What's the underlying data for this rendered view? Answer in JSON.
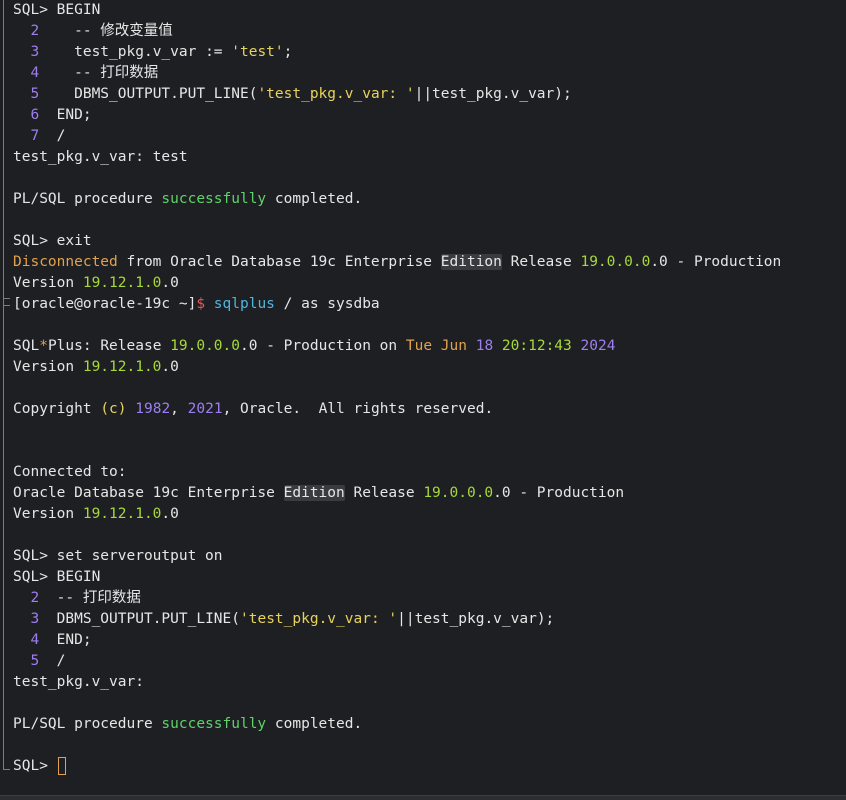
{
  "lines": [
    [
      {
        "t": "SQL> BEGIN",
        "c": "t-normal"
      }
    ],
    [
      {
        "t": "  2",
        "c": "t-num"
      },
      {
        "t": "    -- 修改变量值",
        "c": "t-normal"
      }
    ],
    [
      {
        "t": "  3",
        "c": "t-num"
      },
      {
        "t": "    test_pkg.v_var := ",
        "c": "t-normal"
      },
      {
        "t": "'test'",
        "c": "t-yellow"
      },
      {
        "t": ";",
        "c": "t-normal"
      }
    ],
    [
      {
        "t": "  4",
        "c": "t-num"
      },
      {
        "t": "    -- 打印数据",
        "c": "t-normal"
      }
    ],
    [
      {
        "t": "  5",
        "c": "t-num"
      },
      {
        "t": "    DBMS_OUTPUT.PUT_LINE(",
        "c": "t-normal"
      },
      {
        "t": "'test_pkg.v_var: '",
        "c": "t-yellow"
      },
      {
        "t": "||test_pkg.v_var);",
        "c": "t-normal"
      }
    ],
    [
      {
        "t": "  6",
        "c": "t-num"
      },
      {
        "t": "  END;",
        "c": "t-normal"
      }
    ],
    [
      {
        "t": "  7",
        "c": "t-num"
      },
      {
        "t": "  /",
        "c": "t-normal"
      }
    ],
    [
      {
        "t": "test_pkg.v_var: test",
        "c": "t-normal"
      }
    ],
    [],
    [
      {
        "t": "PL/SQL procedure ",
        "c": "t-normal"
      },
      {
        "t": "successfully",
        "c": "t-green"
      },
      {
        "t": " completed.",
        "c": "t-normal"
      }
    ],
    [],
    [
      {
        "t": "SQL> exit",
        "c": "t-normal"
      }
    ],
    [
      {
        "t": "Disconnected",
        "c": "t-orange"
      },
      {
        "t": " from Oracle Database 19c Enterprise ",
        "c": "t-normal"
      },
      {
        "t": "Edition",
        "c": "t-normal",
        "hl": true
      },
      {
        "t": " Release ",
        "c": "t-normal"
      },
      {
        "t": "19.0.0.0",
        "c": "t-ygreen"
      },
      {
        "t": ".0 - Production",
        "c": "t-normal"
      }
    ],
    [
      {
        "t": "Version ",
        "c": "t-normal"
      },
      {
        "t": "19.12.1.0",
        "c": "t-ygreen"
      },
      {
        "t": ".0",
        "c": "t-normal"
      }
    ],
    [
      {
        "t": "[oracle@oracle-19c ~]",
        "c": "t-normal"
      },
      {
        "t": "$",
        "c": "t-red"
      },
      {
        "t": " sqlplus",
        "c": "t-cyan"
      },
      {
        "t": " / as sysdba",
        "c": "t-normal"
      }
    ],
    [],
    [
      {
        "t": "SQL",
        "c": "t-normal"
      },
      {
        "t": "*",
        "c": "t-orange"
      },
      {
        "t": "Plus: Release ",
        "c": "t-normal"
      },
      {
        "t": "19.0.0.0",
        "c": "t-ygreen"
      },
      {
        "t": ".0 - Production on ",
        "c": "t-normal"
      },
      {
        "t": "Tue Jun ",
        "c": "t-orange"
      },
      {
        "t": "18",
        "c": "t-num"
      },
      {
        "t": " ",
        "c": "t-normal"
      },
      {
        "t": "20:12:43",
        "c": "t-ygreen"
      },
      {
        "t": " ",
        "c": "t-normal"
      },
      {
        "t": "2024",
        "c": "t-num"
      }
    ],
    [
      {
        "t": "Version ",
        "c": "t-normal"
      },
      {
        "t": "19.12.1.0",
        "c": "t-ygreen"
      },
      {
        "t": ".0",
        "c": "t-normal"
      }
    ],
    [],
    [
      {
        "t": "Copyright ",
        "c": "t-normal"
      },
      {
        "t": "(c)",
        "c": "t-yellow"
      },
      {
        "t": " ",
        "c": "t-normal"
      },
      {
        "t": "1982",
        "c": "t-num"
      },
      {
        "t": ", ",
        "c": "t-normal"
      },
      {
        "t": "2021",
        "c": "t-num"
      },
      {
        "t": ", Oracle.  All rights reserved.",
        "c": "t-normal"
      }
    ],
    [],
    [],
    [
      {
        "t": "Connected to:",
        "c": "t-normal"
      }
    ],
    [
      {
        "t": "Oracle Database 19c Enterprise ",
        "c": "t-normal"
      },
      {
        "t": "Edition",
        "c": "t-normal",
        "hl": true
      },
      {
        "t": " Release ",
        "c": "t-normal"
      },
      {
        "t": "19.0.0.0",
        "c": "t-ygreen"
      },
      {
        "t": ".0 - Production",
        "c": "t-normal"
      }
    ],
    [
      {
        "t": "Version ",
        "c": "t-normal"
      },
      {
        "t": "19.12.1.0",
        "c": "t-ygreen"
      },
      {
        "t": ".0",
        "c": "t-normal"
      }
    ],
    [],
    [
      {
        "t": "SQL> set serveroutput on",
        "c": "t-normal"
      }
    ],
    [
      {
        "t": "SQL> BEGIN",
        "c": "t-normal"
      }
    ],
    [
      {
        "t": "  2",
        "c": "t-num"
      },
      {
        "t": "  -- 打印数据",
        "c": "t-normal"
      }
    ],
    [
      {
        "t": "  3",
        "c": "t-num"
      },
      {
        "t": "  DBMS_OUTPUT.PUT_LINE(",
        "c": "t-normal"
      },
      {
        "t": "'test_pkg.v_var: '",
        "c": "t-yellow"
      },
      {
        "t": "||test_pkg.v_var);",
        "c": "t-normal"
      }
    ],
    [
      {
        "t": "  4",
        "c": "t-num"
      },
      {
        "t": "  END;",
        "c": "t-normal"
      }
    ],
    [
      {
        "t": "  5",
        "c": "t-num"
      },
      {
        "t": "  /",
        "c": "t-normal"
      }
    ],
    [
      {
        "t": "test_pkg.v_var:",
        "c": "t-normal"
      }
    ],
    [],
    [
      {
        "t": "PL/SQL procedure ",
        "c": "t-normal"
      },
      {
        "t": "successfully",
        "c": "t-green"
      },
      {
        "t": " completed.",
        "c": "t-normal"
      }
    ],
    [],
    [
      {
        "t": "SQL> ",
        "c": "t-normal",
        "cursor": true
      }
    ]
  ],
  "colors": {
    "background": "#1e1f22",
    "text": "#e6e6e6",
    "line_number": "#9d7ff0",
    "success": "#5fd26a",
    "version": "#a6d83a",
    "string": "#e8d35a",
    "warning": "#e0a24e",
    "command": "#4fb6e0",
    "prompt_symbol": "#e05a5a",
    "highlight_bg": "#3a3b40"
  }
}
